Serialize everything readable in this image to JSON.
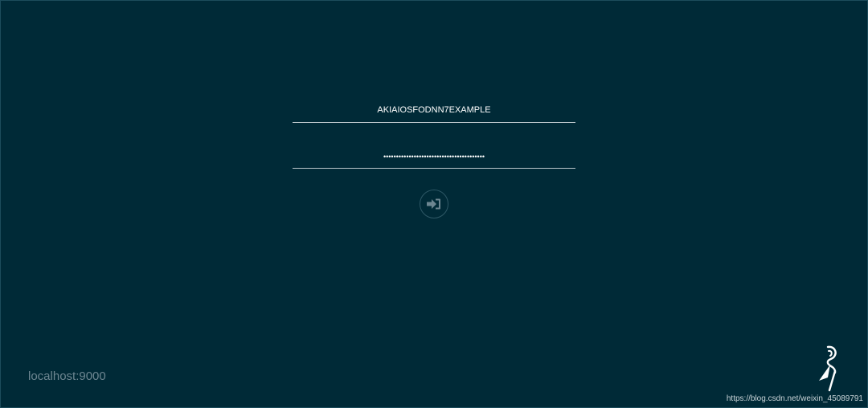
{
  "login": {
    "access_key": "AKIAIOSFODNN7EXAMPLE",
    "secret_key_masked": "••••••••••••••••••••••••••••••••••••••••"
  },
  "footer": {
    "host": "localhost:9000",
    "watermark": "https://blog.csdn.net/weixin_45089791"
  },
  "icons": {
    "submit": "sign-in-icon",
    "logo": "minio-heron-logo"
  },
  "colors": {
    "background": "#002a37",
    "field_underline": "#bcc7cc",
    "button_border": "#2e5866",
    "button_icon": "#6d8691",
    "host_text": "#6d8691"
  }
}
